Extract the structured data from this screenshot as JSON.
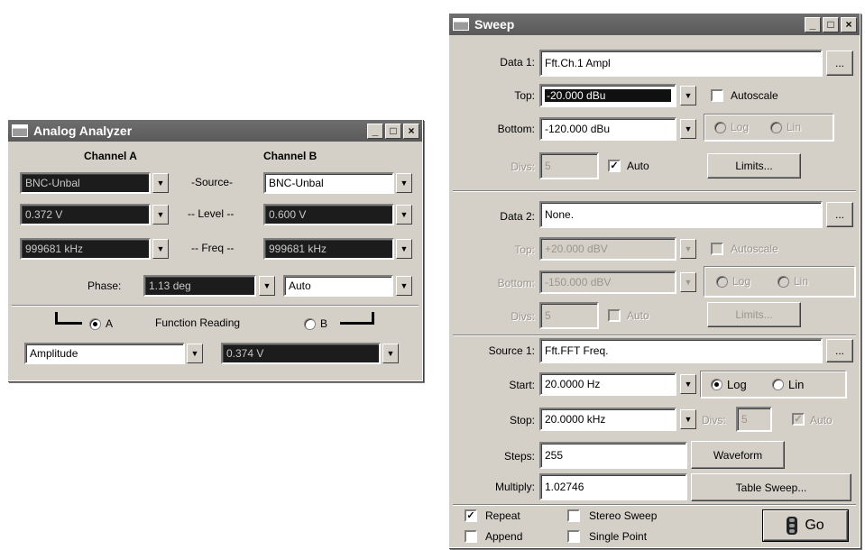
{
  "analog": {
    "title": "Analog Analyzer",
    "channel_a_header": "Channel A",
    "channel_b_header": "Channel B",
    "source_label": "-Source-",
    "level_label": "-- Level --",
    "freq_label": "-- Freq --",
    "source_a": "BNC-Unbal",
    "source_b": "BNC-Unbal",
    "level_a": "0.372   V",
    "level_b": "0.600   V",
    "freq_a": "999681 kHz",
    "freq_b": "999681 kHz",
    "phase_label": "Phase:",
    "phase_value": "1.13   deg",
    "phase_mode": "Auto",
    "radio_a_label": "A",
    "radio_b_label": "B",
    "function_reading_label": "Function Reading",
    "function_select": "Amplitude",
    "function_value": "0.374   V"
  },
  "sweep": {
    "title": "Sweep",
    "data1_label": "Data 1:",
    "data1_value": "Fft.Ch.1 Ampl",
    "top_label": "Top:",
    "top_value": "-20.000  dBu",
    "autoscale_label": "Autoscale",
    "bottom_label": "Bottom:",
    "bottom_value": "-120.000 dBu",
    "log_label": "Log",
    "lin_label": "Lin",
    "divs_label": "Divs:",
    "divs_value": "5",
    "auto_label": "Auto",
    "limits_label": "Limits...",
    "data2_label": "Data 2:",
    "data2_value": "None.",
    "top2_value": "+20.000  dBV",
    "bottom2_value": "-150.000 dBV",
    "divs2_value": "5",
    "source1_label": "Source 1:",
    "source1_value": "Fft.FFT Freq.",
    "start_label": "Start:",
    "start_value": "20.0000  Hz",
    "stop_label": "Stop:",
    "stop_value": "20.0000 kHz",
    "divs3_value": "5",
    "steps_label": "Steps:",
    "steps_value": "255",
    "waveform_label": "Waveform",
    "multiply_label": "Multiply:",
    "multiply_value": "1.02746",
    "table_sweep_label": "Table Sweep...",
    "repeat_label": "Repeat",
    "append_label": "Append",
    "stereo_label": "Stereo Sweep",
    "single_point_label": "Single Point",
    "go_label": "Go",
    "browse_label": "..."
  },
  "title_buttons": {
    "minimize": "_",
    "maximize": "□",
    "close": "×"
  },
  "glyphs": {
    "arrow": "▼",
    "check": "✓"
  },
  "icons": [
    "window-icon",
    "dropdown-arrow-icon",
    "checkmark-icon",
    "traffic-light-icon"
  ]
}
